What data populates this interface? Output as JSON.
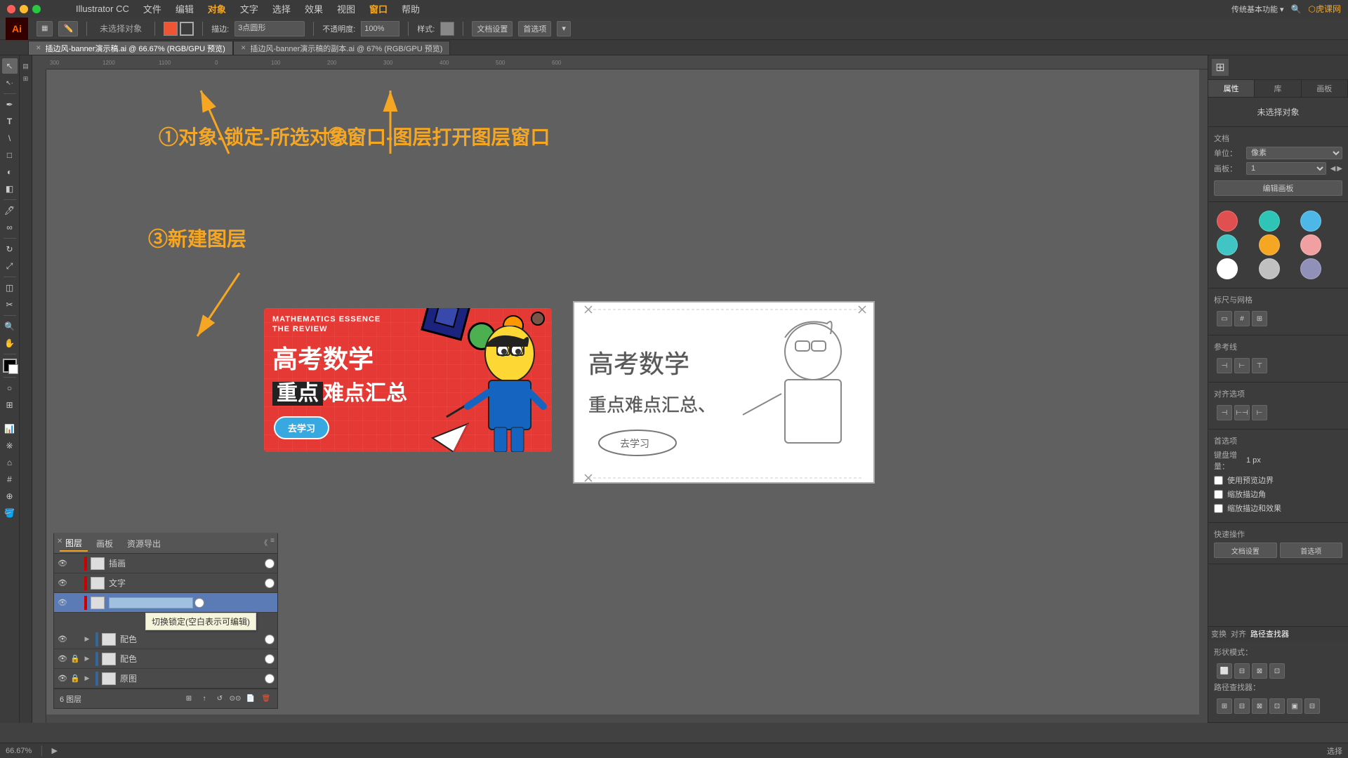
{
  "app": {
    "name": "Illustrator CC",
    "logo": "Ai",
    "zoom": "66.67%"
  },
  "macos": {
    "apple_menu": "",
    "menus": [
      "Illustrator CC",
      "文件",
      "编辑",
      "对象",
      "文字",
      "选择",
      "效果",
      "视图",
      "窗口",
      "帮助"
    ]
  },
  "toolbar": {
    "stroke_label": "描边:",
    "stroke_value": "3点圆形",
    "opacity_label": "不透明度:",
    "opacity_value": "100%",
    "style_label": "样式:",
    "doc_settings": "文档设置",
    "preferences": "首选项"
  },
  "tabs": [
    {
      "label": "插边风-banner演示稿.ai @ 66.67% (RGB/GPU 预览)",
      "active": true
    },
    {
      "label": "插边风-banner演示稿的副本.ai @ 67% (RGB/GPU 预览)",
      "active": false
    }
  ],
  "annotations": {
    "step1": "①对象-锁定-所选对象",
    "step2": "②窗口-图层打开图层窗口",
    "step3": "③新建图层"
  },
  "layers_panel": {
    "tabs": [
      "图层",
      "画板",
      "资源导出"
    ],
    "layers": [
      {
        "name": "插画",
        "visible": true,
        "locked": false,
        "color": "#cc0000"
      },
      {
        "name": "文字",
        "visible": true,
        "locked": false,
        "color": "#cc0000"
      },
      {
        "name": "",
        "visible": true,
        "locked": false,
        "color": "#cc0000",
        "editing": true
      },
      {
        "name": "配色",
        "visible": true,
        "locked": false,
        "color": "#336699",
        "has_sub": true
      },
      {
        "name": "配色",
        "visible": true,
        "locked": true,
        "color": "#336699",
        "has_sub": true
      },
      {
        "name": "原图",
        "visible": true,
        "locked": true,
        "color": "#336699",
        "has_sub": true
      }
    ],
    "footer": {
      "count_text": "6 图层",
      "buttons": [
        "+",
        "⊞",
        "↺",
        "⊙⊙",
        "✕"
      ]
    }
  },
  "tooltip": {
    "text": "切换锁定(空白表示可编辑)"
  },
  "right_panel": {
    "tabs": [
      "属性",
      "库",
      "画板"
    ],
    "no_selection": "未选择对象",
    "doc_section": {
      "title": "文档",
      "unit_label": "单位：",
      "unit_value": "像素",
      "template_label": "画板：",
      "template_value": "1",
      "edit_template_btn": "编辑画板"
    },
    "rulers_section": {
      "title": "标尺与网格"
    },
    "guides_section": {
      "title": "参考线"
    },
    "snap_section": {
      "title": "对齐选项"
    },
    "preferences_section": {
      "title": "首选项",
      "keyboard_label": "键盘增量：",
      "keyboard_value": "1 px",
      "snap_checkbox": "使用预览边界",
      "snap_value": false,
      "corner_checkbox": "缩放描边角",
      "corner_value": false,
      "effects_checkbox": "缩放描边和效果",
      "effects_value": false
    },
    "quick_actions": {
      "title": "快速操作",
      "doc_settings_btn": "文档设置",
      "preferences_btn": "首选项"
    },
    "swatches": [
      {
        "color": "#e05050",
        "name": "red"
      },
      {
        "color": "#2ec4b6",
        "name": "teal"
      },
      {
        "color": "#4db8e8",
        "name": "sky-blue"
      },
      {
        "color": "#40c4c4",
        "name": "cyan"
      },
      {
        "color": "#f5a623",
        "name": "orange"
      },
      {
        "color": "#f0a0a0",
        "name": "pink"
      },
      {
        "color": "#ffffff",
        "name": "white"
      },
      {
        "color": "#c0c0c0",
        "name": "gray"
      },
      {
        "color": "#9090b8",
        "name": "purple-gray"
      }
    ]
  },
  "path_finder": {
    "title": "路径查找器",
    "shape_modes_label": "形状模式：",
    "path_finder_label": "路径查找器："
  },
  "status_bar": {
    "zoom": "66.67%",
    "mode": "选择"
  },
  "banner": {
    "subtitle": "MATHEMATICS ESSENCE",
    "title_line2": "THE REVIEW",
    "main_title": "高考数学",
    "subtitle2": "重点难点汇总",
    "cta_button": "去学习"
  },
  "sketch": {
    "main_title": "高考数学",
    "subtitle": "重点难点汇总、",
    "cta_button": "去学习"
  }
}
